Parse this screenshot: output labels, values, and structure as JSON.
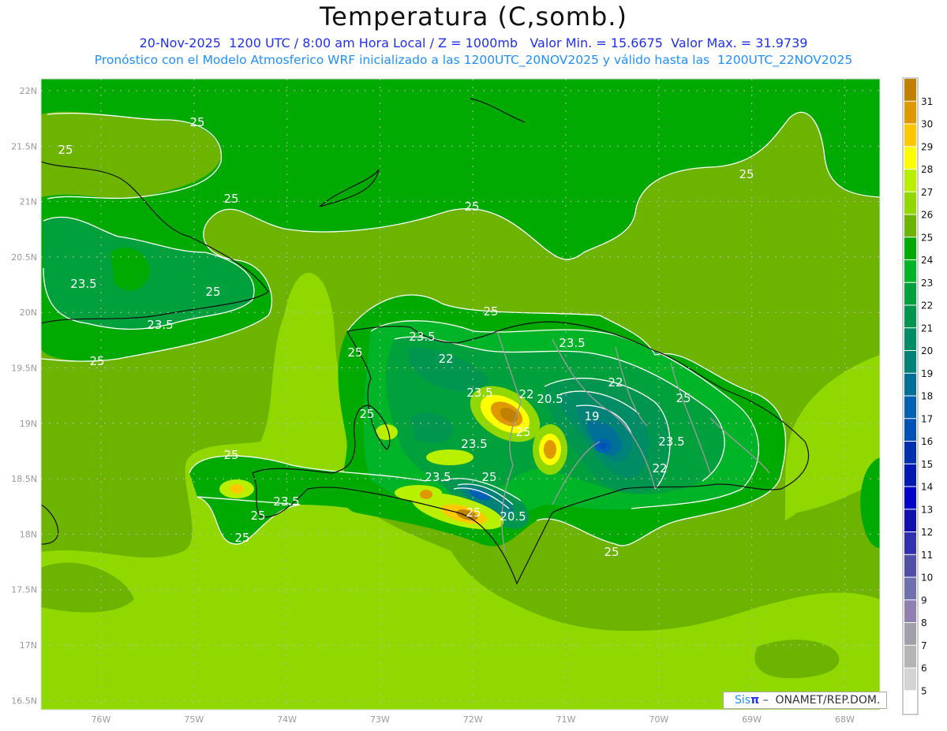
{
  "header": {
    "title": "Temperatura (C,somb.)",
    "line1": "20-Nov-2025  1200 UTC / 8:00 am Hora Local / Z = 1000mb   Valor Min. = 15.6675  Valor Max. = 31.9739",
    "line2": "Pronóstico con el Modelo Atmosferico WRF inicializado a las 1200UTC_20NOV2025 y válido hasta las  1200UTC_22NOV2025"
  },
  "axes": {
    "lat_labels": [
      "22N",
      "21.5N",
      "21N",
      "20.5N",
      "20N",
      "19.5N",
      "19N",
      "18.5N",
      "18N",
      "17.5N",
      "17N",
      "16.5N"
    ],
    "lat_values": [
      22,
      21.5,
      21,
      20.5,
      20,
      19.5,
      19,
      18.5,
      18,
      17.5,
      17,
      16.5
    ],
    "lon_labels": [
      "76W",
      "75W",
      "74W",
      "73W",
      "72W",
      "71W",
      "70W",
      "69W",
      "68W"
    ],
    "lon_values": [
      -76,
      -75,
      -74,
      -73,
      -72,
      -71,
      -70,
      -69,
      -68
    ]
  },
  "contour_labels": [
    "25",
    "25",
    "25",
    "25",
    "25",
    "23.5",
    "25",
    "23.5",
    "25",
    "25",
    "23.5",
    "25",
    "22",
    "23.5",
    "22",
    "25",
    "23.5",
    "22",
    "20.5",
    "19",
    "25",
    "25",
    "23.5",
    "23.5",
    "25",
    "23.5",
    "25",
    "22",
    "23.5",
    "25",
    "25",
    "20.5",
    "25",
    "25"
  ],
  "colorbar": {
    "labels": [
      "31",
      "30",
      "29",
      "28",
      "27",
      "26",
      "25",
      "24",
      "23",
      "22",
      "21",
      "20",
      "19",
      "18",
      "17",
      "16",
      "15",
      "14",
      "13",
      "12",
      "11",
      "10",
      "9",
      "8",
      "7",
      "6",
      "5"
    ],
    "colors": [
      "#c08000",
      "#e09800",
      "#ffc800",
      "#ffff00",
      "#b8f000",
      "#90d800",
      "#6cb400",
      "#00aa00",
      "#00b428",
      "#00a03c",
      "#009650",
      "#008c64",
      "#008278",
      "#007096",
      "#0060b4",
      "#0050b8",
      "#0030b0",
      "#0018b4",
      "#0000c8",
      "#1010b0",
      "#3030b0",
      "#5050a8",
      "#7070b0",
      "#9080b0",
      "#a0a0a8",
      "#b4b4b4",
      "#d4d4d4",
      "#ffffff"
    ]
  },
  "credit": {
    "sis": "Sis",
    "pi": "π",
    "text": " –  ONAMET/REP.DOM."
  }
}
